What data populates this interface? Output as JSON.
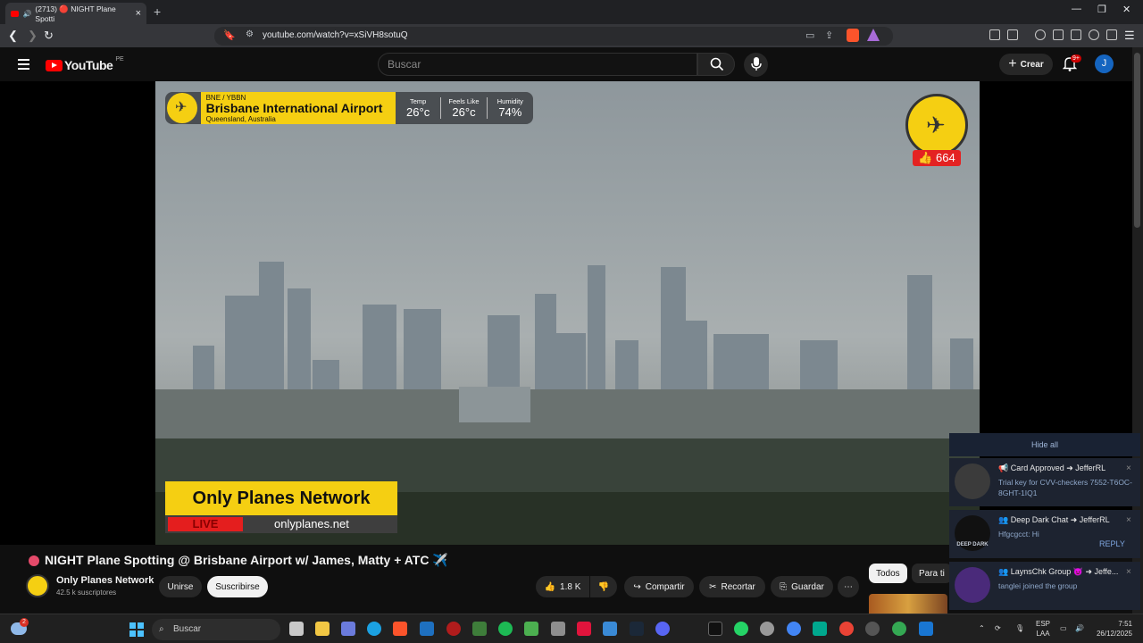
{
  "browser": {
    "tab_title": "(2713) 🔴 NIGHT Plane Spotti",
    "url": "youtube.com/watch?v=xSiVH8sotuQ"
  },
  "youtube": {
    "logo_text": "YouTube",
    "country_code": "PE",
    "search_placeholder": "Buscar",
    "create_label": "Crear",
    "notifications_badge": "9+",
    "avatar_letter": "J"
  },
  "overlay": {
    "code": "BNE / YBBN",
    "airport_name": "Brisbane International Airport",
    "location": "Queensland, Australia",
    "stats": [
      {
        "label": "Temp",
        "value": "26°c"
      },
      {
        "label": "Feels Like",
        "value": "26°c"
      },
      {
        "label": "Humidity",
        "value": "74%"
      }
    ],
    "likes": "664",
    "network_name": "Only Planes Network",
    "live_label": "LIVE",
    "website": "onlyplanes.net"
  },
  "video_info": {
    "title": "NIGHT Plane Spotting @ Brisbane Airport w/ James, Matty + ATC ✈️",
    "channel": "Only Planes Network",
    "subscribers": "42.5 k suscriptores",
    "join_label": "Unirse",
    "subscribe_label": "Suscribirse",
    "likes": "1.8 K",
    "share_label": "Compartir",
    "clip_label": "Recortar",
    "save_label": "Guardar"
  },
  "chips": [
    "Todos",
    "Para ti"
  ],
  "notifications": {
    "hide_all": "Hide all",
    "items": [
      {
        "header": "📢 Card Approved ➜ JefferRL",
        "body": "Trial key for CVV-checkers 7552-T6OC-8GHT-1IQ1"
      },
      {
        "header": "👥 Deep Dark Chat ➜ JefferRL",
        "body": "Hfgcgcct: Hi",
        "action": "REPLY",
        "avatar_text": "DEEP DARK"
      },
      {
        "header": "👥 LaynsChk Group 👿 ➜ Jeffe...",
        "body": "tanglei joined the group"
      }
    ]
  },
  "taskbar": {
    "search_label": "Buscar",
    "lang": "ESP",
    "layout": "LAA",
    "time": "7:51",
    "date": "26/12/2025",
    "weather_badge": "2"
  },
  "colors": {
    "yt_red": "#ff0000",
    "overlay_yellow": "#f5cf12",
    "live_red": "#e41e1e"
  }
}
